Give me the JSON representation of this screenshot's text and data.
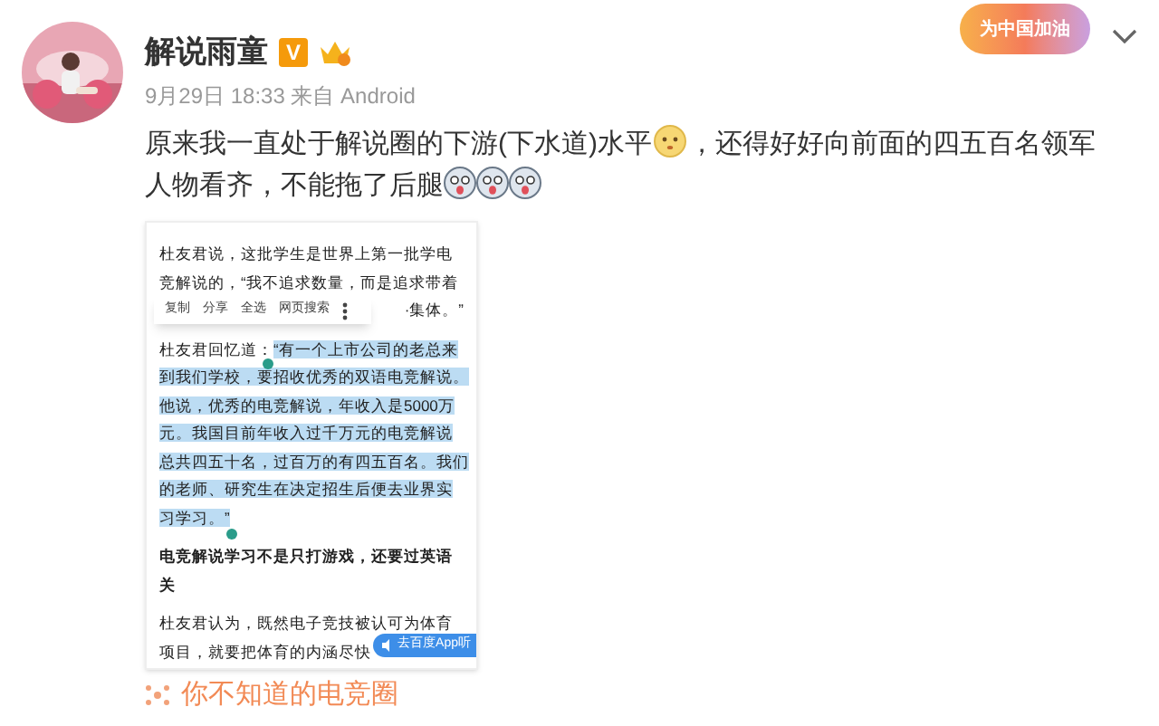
{
  "user": {
    "name": "解说雨童",
    "verified_badge": "V",
    "timestamp": "9月29日 18:33 来自 Android"
  },
  "banner": {
    "text": "为中国加油"
  },
  "post": {
    "segments": [
      {
        "kind": "text",
        "text": "原来我一直处于解说圈的下游(下水道)水平"
      },
      {
        "kind": "emoji"
      },
      {
        "kind": "text",
        "text": "，还得好好向前面的四五百名领军人物看齐，不能拖了后腿"
      },
      {
        "kind": "emoji"
      },
      {
        "kind": "emoji"
      },
      {
        "kind": "emoji"
      }
    ]
  },
  "embedded_screenshot": {
    "paragraphs": [
      {
        "bold": false,
        "lines": [
          [
            {
              "text": "杜友君说，这批学生是世界上第一批学电",
              "highlighted": false
            }
          ],
          [
            {
              "text": "竞解说的，“我不追求数量，而是追求带着",
              "highlighted": false
            }
          ],
          [
            {
              "text": "·集体。”",
              "highlighted": false
            }
          ]
        ]
      },
      {
        "bold": false,
        "lines": [
          [
            {
              "text": "杜友君回忆道：",
              "highlighted": false
            },
            {
              "text": "“有一个上市公司的老总来",
              "highlighted": true
            }
          ],
          [
            {
              "text": "到我们学校，要招收优秀的双语电竞解说。",
              "highlighted": true
            }
          ],
          [
            {
              "text": "他说，优秀的电竞解说，年收入是5000万",
              "highlighted": true
            }
          ],
          [
            {
              "text": "元。我国目前年收入过千万元的电竞解说",
              "highlighted": true
            }
          ],
          [
            {
              "text": "总共四五十名，过百万的有四五百名。我们",
              "highlighted": true
            }
          ],
          [
            {
              "text": "的老师、研究生在决定招生后便去业界实",
              "highlighted": true
            }
          ],
          [
            {
              "text": "习学习。”",
              "highlighted": true
            }
          ]
        ]
      },
      {
        "bold": true,
        "lines": [
          [
            {
              "text": "电竞解说学习不是只打游戏，还要过英语",
              "highlighted": false
            }
          ],
          [
            {
              "text": "关",
              "highlighted": false
            }
          ]
        ]
      },
      {
        "bold": false,
        "lines": [
          [
            {
              "text": "杜友君认为，既然电子竞技被认可为体育",
              "highlighted": false
            }
          ],
          [
            {
              "text": "项目，就要把体育的内涵尽快",
              "highlighted": false
            }
          ]
        ]
      }
    ],
    "context_menu": [
      "复制",
      "分享",
      "全选",
      "网页搜索"
    ],
    "listen_button": "去百度App听"
  },
  "topic": {
    "text": "你不知道的电竞圈"
  }
}
